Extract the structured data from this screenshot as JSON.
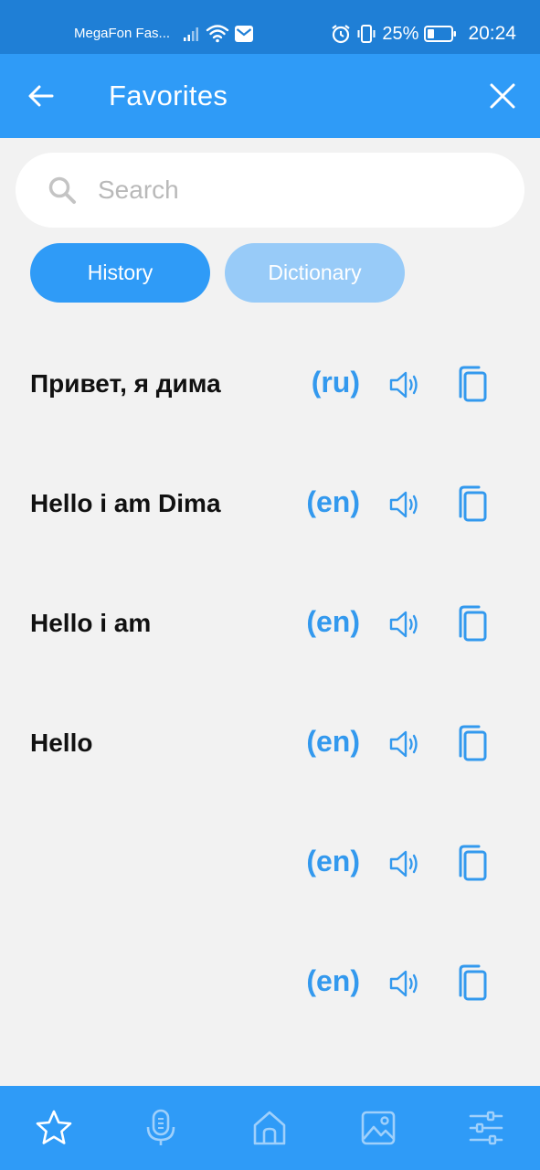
{
  "status_bar": {
    "carrier": "MegaFon Fas...",
    "battery": "25%",
    "time": "20:24"
  },
  "app_bar": {
    "title": "Favorites",
    "back_icon": "arrow-left-icon",
    "close_icon": "close-icon"
  },
  "search": {
    "placeholder": "Search",
    "value": ""
  },
  "tabs": [
    {
      "label": "History",
      "active": true
    },
    {
      "label": "Dictionary",
      "active": false
    }
  ],
  "items": [
    {
      "text": "Привет, я дима",
      "lang": "(ru)"
    },
    {
      "text": "Hello i am Dima",
      "lang": "(en)"
    },
    {
      "text": "Hello i am",
      "lang": "(en)"
    },
    {
      "text": "Hello",
      "lang": "(en)"
    },
    {
      "text": "",
      "lang": "(en)"
    },
    {
      "text": "",
      "lang": "(en)"
    }
  ],
  "bottom_nav": [
    {
      "icon": "star-icon",
      "active": true
    },
    {
      "icon": "microphone-icon",
      "active": false
    },
    {
      "icon": "home-icon",
      "active": false
    },
    {
      "icon": "image-icon",
      "active": false
    },
    {
      "icon": "sliders-icon",
      "active": false
    }
  ],
  "colors": {
    "status_bar": "#1f7fd6",
    "primary": "#2f9bf7",
    "tab_inactive": "#98cbf8",
    "accent_text": "#3399ee",
    "background": "#f2f2f2"
  }
}
